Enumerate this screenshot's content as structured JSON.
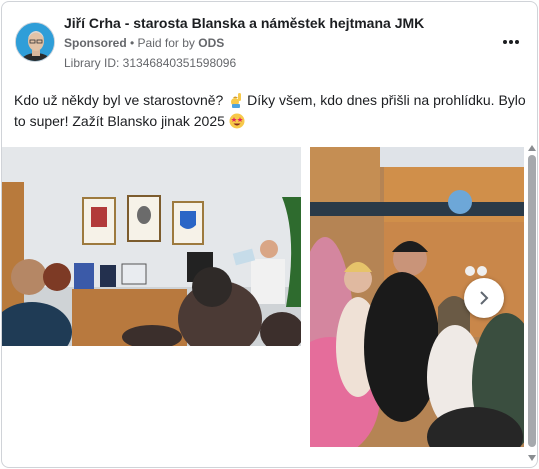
{
  "header": {
    "page_name": "Jiří Crha - starosta Blanska a náměstek hejtmana JMK",
    "sponsored": "Sponsored",
    "separator": " • ",
    "paid_for_by": "Paid for by ",
    "funder": "ODS",
    "library_id": "Library ID: 31346840351598096"
  },
  "post": {
    "text_part1": "Kdo už někdy byl ve starostovně? ",
    "text_part2": " Díky všem, kdo dnes přišli na prohlídku. Bylo to super! Zažít Blansko jinak 2025 ",
    "emoji1": "raising-hand-emoji",
    "emoji2": "star-struck-emoji"
  },
  "icons": {
    "more": "more-options-icon",
    "next": "chevron-right-icon"
  },
  "colors": {
    "text_primary": "#1c1e21",
    "text_secondary": "#65676b",
    "border": "#d0d3d8"
  }
}
